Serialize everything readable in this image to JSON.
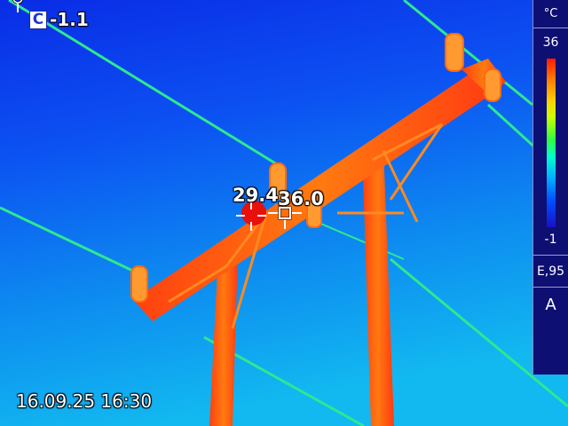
{
  "overlay": {
    "mode_letter": "C",
    "spot_value": "-1.1",
    "datetime": "16.09.25 16:30"
  },
  "palette": {
    "unit": "°C",
    "max": "36",
    "min": "-1",
    "emissivity": "E,95",
    "range_mode": "A"
  },
  "measurements": {
    "marker1_value": "29.4",
    "marker2_value": "36.0"
  },
  "icons": {
    "topleft": "crosshair-icon",
    "marker1": "crosshair-red-icon",
    "marker2": "crosshair-square-icon"
  },
  "colors": {
    "sky_top": "#0a32e8",
    "sky_bottom": "#10b4f0",
    "hot_structure": "#ff6a10",
    "cable": "#30e890",
    "panel_bg": "#0e0f73"
  }
}
